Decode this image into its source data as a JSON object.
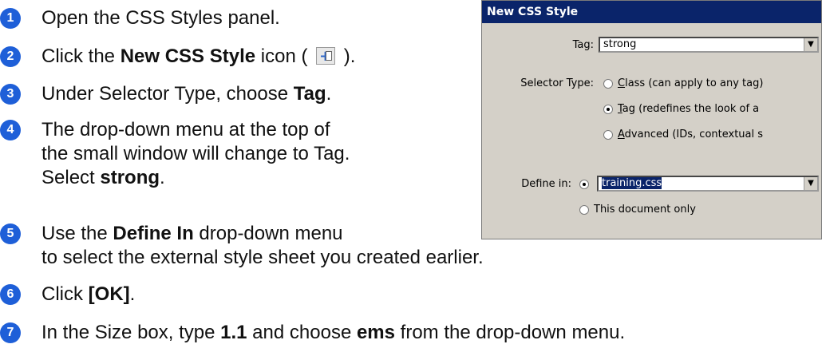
{
  "steps": [
    {
      "num": "1",
      "parts": [
        "Open the CSS Styles panel."
      ]
    },
    {
      "num": "2",
      "parts": [
        "Click the ",
        "New CSS Style",
        " icon ( ",
        " )."
      ]
    },
    {
      "num": "3",
      "parts": [
        "Under Selector Type, choose ",
        "Tag",
        "."
      ]
    },
    {
      "num": "4",
      "lines": [
        "The drop-down menu at the top of",
        "the small window will change to Tag.",
        "Select ",
        "strong",
        "."
      ]
    },
    {
      "num": "5",
      "lines": [
        "Use the ",
        "Define In",
        " drop-down menu",
        "to select the external style sheet you created earlier."
      ]
    },
    {
      "num": "6",
      "parts": [
        "Click ",
        "[OK]",
        "."
      ]
    },
    {
      "num": "7",
      "parts": [
        "In the Size box, type ",
        "1.1",
        " and choose ",
        "ems",
        " from the drop-down menu."
      ]
    }
  ],
  "dialog": {
    "title": "New CSS Style",
    "tag_label": "Tag:",
    "tag_value": "strong",
    "selector_type_label": "Selector Type:",
    "selector_options": [
      {
        "first_letter": "C",
        "rest": "lass (can apply to any tag)",
        "checked": false
      },
      {
        "first_letter": "T",
        "rest": "ag (redefines the look of a",
        "checked": true
      },
      {
        "first_letter": "A",
        "rest": "dvanced (IDs, contextual s",
        "checked": false
      }
    ],
    "define_in_label": "Define in:",
    "define_in_value": "training.css",
    "define_in_alt": "This document only"
  },
  "colors": {
    "step_badge": "#1e5fd8",
    "title_bar": "#0a246a",
    "dialog_bg": "#d4d0c8"
  }
}
